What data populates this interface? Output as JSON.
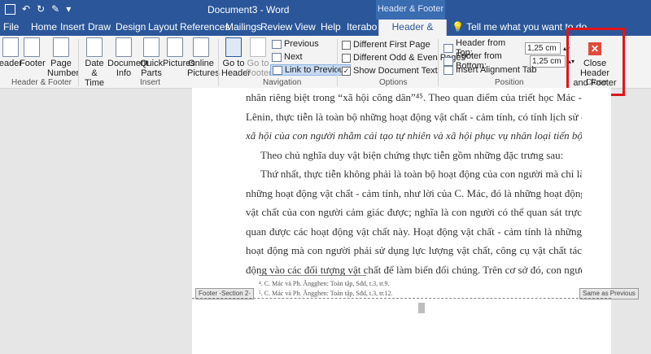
{
  "titlebar": {
    "doc_title": "Document3 - Word",
    "tools_label": "Header & Footer Tools"
  },
  "tabs": [
    {
      "label": "File"
    },
    {
      "label": "Home"
    },
    {
      "label": "Insert"
    },
    {
      "label": "Draw"
    },
    {
      "label": "Design"
    },
    {
      "label": "Layout"
    },
    {
      "label": "References"
    },
    {
      "label": "Mailings"
    },
    {
      "label": "Review"
    },
    {
      "label": "View"
    },
    {
      "label": "Help"
    },
    {
      "label": "Iterabox"
    },
    {
      "label": "Header & Footer"
    }
  ],
  "tell_me": "Tell me what you want to do",
  "ribbon": {
    "hf": {
      "header": "eader",
      "footer": "Footer",
      "page_number_1": "Page",
      "page_number_2": "Number",
      "group": "Header & Footer"
    },
    "insert": {
      "date_1": "Date &",
      "date_2": "Time",
      "docinfo_1": "Document",
      "docinfo_2": "Info",
      "quick_1": "Quick",
      "quick_2": "Parts",
      "pictures": "Pictures",
      "online_1": "Online",
      "online_2": "Pictures",
      "group": "Insert"
    },
    "nav": {
      "goto_header_1": "Go to",
      "goto_header_2": "Header",
      "goto_footer_1": "Go to",
      "goto_footer_2": "Footer",
      "previous": "Previous",
      "next": "Next",
      "link": "Link to Previous",
      "group": "Navigation"
    },
    "options": {
      "diff_first": "Different First Page",
      "diff_odd": "Different Odd & Even Pages",
      "show_doc": "Show Document Text",
      "group": "Options"
    },
    "position": {
      "header_from_top": "Header from Top:",
      "header_value": "1,25 cm",
      "footer_from_bottom": "Footer from Bottom:",
      "footer_value": "1,25 cm",
      "insert_tab": "Insert Alignment Tab",
      "group": "Position"
    },
    "close": {
      "label_1": "Close Header",
      "label_2": "and Footer",
      "group": "Close"
    }
  },
  "document": {
    "lines": [
      "nhân riêng biệt trong “xã hội công dân”⁴⁵. Theo quan điểm của triết học Mác -",
      "Lênin, thực tiễn là toàn bộ những hoạt động vật chất - cảm tính, có tính lịch sử -",
      "xã hội của con người nhằm cải tạo tự nhiên và xã hội phục vụ nhân loại tiến bộ.",
      "Theo chủ nghĩa duy vật biện chứng thực tiễn gồm những đặc trưng sau:",
      "Thứ nhất, thực tiễn không phải là toàn bộ hoạt động của con người mà chỉ là",
      "những hoạt động vật chất - cảm tính, như lời của C. Mác, đó là những hoạt động",
      "vật chất của con người cảm giác được; nghĩa là con người có thể quan sát trực",
      "quan được các hoạt động vật chất này. Hoạt động vật chất - cảm tính là những",
      "hoạt động mà con người phải sử dụng lực lượng vật chất, công cụ vật chất tác",
      "động vào các đối tượng vật chất để làm biến đổi chúng. Trên cơ sở đó, con người"
    ],
    "footnotes": [
      "⁴. C. Mác và Ph. Ăngghen: Toàn tập, Sđd, t.3, tr.9.",
      "⁵. C. Mác và Ph. Ăngghen: Toàn tập, Sđd, t.3, tr.12."
    ],
    "footer_section": "Footer -Section 2-",
    "same_as_previous": "Same as Previous"
  }
}
